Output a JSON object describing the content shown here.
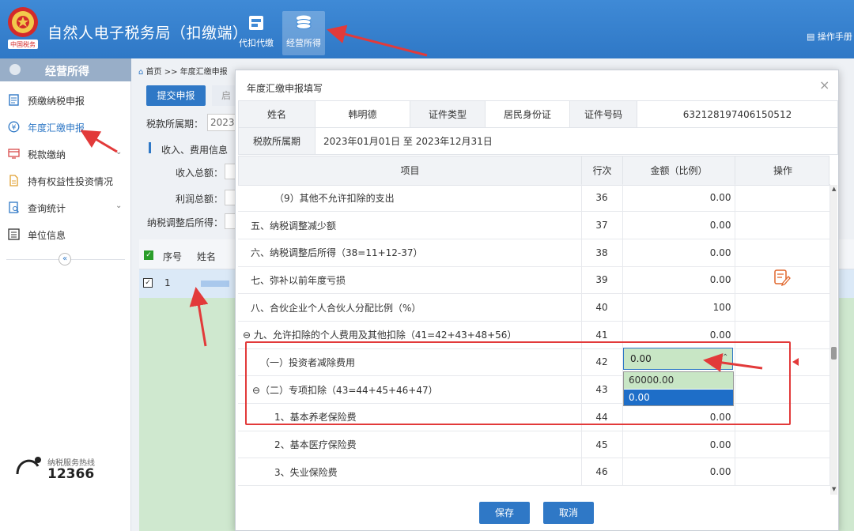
{
  "app": {
    "title": "自然人电子税务局（扣缴端）",
    "manual": "操作手册",
    "emblem_text": "中国税务"
  },
  "top_nav": [
    {
      "label": "代扣代缴",
      "icon": "withholding-icon"
    },
    {
      "label": "经营所得",
      "icon": "coins-icon"
    }
  ],
  "sidebar": {
    "header": "经营所得",
    "items": [
      {
        "label": "预缴纳税申报",
        "icon": "document-icon"
      },
      {
        "label": "年度汇缴申报",
        "icon": "yen-circle-icon"
      },
      {
        "label": "税款缴纳",
        "icon": "payment-icon"
      },
      {
        "label": "持有权益性投资情况",
        "icon": "file-icon"
      },
      {
        "label": "查询统计",
        "icon": "search-doc-icon"
      },
      {
        "label": "单位信息",
        "icon": "list-icon"
      }
    ],
    "collapse": "«",
    "hotline_label": "纳税服务热线",
    "hotline_number": "12366"
  },
  "background": {
    "breadcrumb": "首页 >> 年度汇缴申报",
    "submit": "提交申报",
    "second_btn": "启",
    "period_label": "税款所属期：",
    "period_value": "2023",
    "section": "收入、费用信息",
    "income_label": "收入总额：",
    "profit_label": "利润总额：",
    "adjusted_label": "纳税调整后所得：",
    "col_no": "序号",
    "col_name": "姓名",
    "row_no": "1"
  },
  "modal": {
    "title": "年度汇缴申报填写",
    "close": "×",
    "info": {
      "name_label": "姓名",
      "name_value": "韩明德",
      "idtype_label": "证件类型",
      "idtype_value": "居民身份证",
      "idno_label": "证件号码",
      "idno_value": "632128197406150512",
      "period_label": "税款所属期",
      "period_value": "2023年01月01日 至 2023年12月31日"
    },
    "columns": {
      "item": "项目",
      "line": "行次",
      "amount": "金额（比例）",
      "action": "操作"
    },
    "rows": [
      {
        "item": "（9）其他不允许扣除的支出",
        "line": "36",
        "amount": "0.00"
      },
      {
        "item": "五、纳税调整减少额",
        "line": "37",
        "amount": "0.00"
      },
      {
        "item": "六、纳税调整后所得（38=11+12-37）",
        "line": "38",
        "amount": "0.00"
      },
      {
        "item": "七、弥补以前年度亏损",
        "line": "39",
        "amount": "0.00"
      },
      {
        "item": "八、合伙企业个人合伙人分配比例（%）",
        "line": "40",
        "amount": "100"
      },
      {
        "item": "⊖ 九、允许扣除的个人费用及其他扣除（41=42+43+48+56）",
        "line": "41",
        "amount": "0.00"
      },
      {
        "item": "（一）投资者减除费用",
        "line": "42",
        "amount": ""
      },
      {
        "item": "⊖（二）专项扣除（43=44+45+46+47）",
        "line": "43",
        "amount": ""
      },
      {
        "item": "1、基本养老保险费",
        "line": "44",
        "amount": "0.00"
      },
      {
        "item": "2、基本医疗保险费",
        "line": "45",
        "amount": "0.00"
      },
      {
        "item": "3、失业保险费",
        "line": "46",
        "amount": "0.00"
      }
    ],
    "dropdown": {
      "value": "0.00",
      "options": [
        "60000.00",
        "0.00"
      ]
    },
    "save": "保存",
    "cancel": "取消"
  },
  "colors": {
    "primary": "#2f78c6",
    "highlight_green": "#c8e6c5",
    "annotation_red": "#e23a3a"
  }
}
